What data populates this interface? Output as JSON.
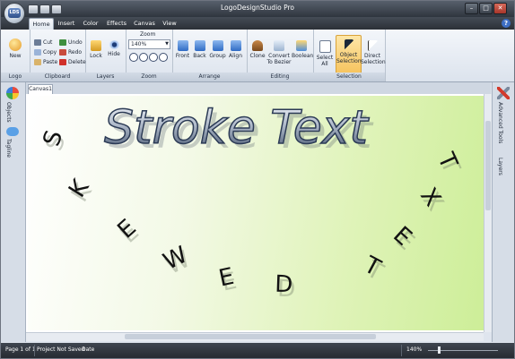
{
  "app": {
    "title": "LogoDesignStudio Pro"
  },
  "window_controls": {
    "minimize": "–",
    "maximize": "□",
    "close": "✕"
  },
  "tabs": [
    {
      "label": "Home",
      "active": true
    },
    {
      "label": "Insert"
    },
    {
      "label": "Color"
    },
    {
      "label": "Effects"
    },
    {
      "label": "Canvas"
    },
    {
      "label": "View"
    }
  ],
  "help": "?",
  "ribbon": {
    "groups": {
      "logo": "Logo",
      "clipboard": "Clipboard",
      "layers": "Layers",
      "zoom": "Zoom",
      "arrange": "Arrange",
      "editing": "Editing",
      "selection": "Selection"
    },
    "new_label": "New",
    "cut": "Cut",
    "copy": "Copy",
    "paste": "Paste",
    "undo": "Undo",
    "redo": "Redo",
    "delete": "Delete",
    "lock": "Lock",
    "hide": "Hide",
    "zoom_title": "Zoom",
    "zoom_value": "140%",
    "front": "Front",
    "back": "Back",
    "group": "Group",
    "align": "Align",
    "clone": "Clone",
    "convert_line1": "Convert",
    "convert_line2": "To Bezier",
    "boolean": "Boolean",
    "select_all_line1": "Select",
    "select_all_line2": "All",
    "object_sel_line1": "Object",
    "object_sel_line2": "Selection",
    "direct_sel_line1": "Direct",
    "direct_sel_line2": "Selection"
  },
  "left_panel": {
    "objects": "Objects",
    "tagline": "Tagline"
  },
  "right_panel": {
    "advanced_tools": "Advanced Tools",
    "layers": "Layers"
  },
  "document_tab": "Canvas1",
  "canvas": {
    "stroke_text": "Stroke Text",
    "skewed_letters": [
      "S",
      "K",
      "E",
      "W",
      "E",
      "D",
      "T",
      "E",
      "X",
      "T"
    ]
  },
  "statusbar": {
    "page": "Page 1 of 1",
    "project": "Project Not Saved",
    "date": "Date",
    "zoom": "140%"
  },
  "colors": {
    "accent": "#f6c25a",
    "title_bar": "#2f353e",
    "canvas_green": "#cdee98"
  }
}
